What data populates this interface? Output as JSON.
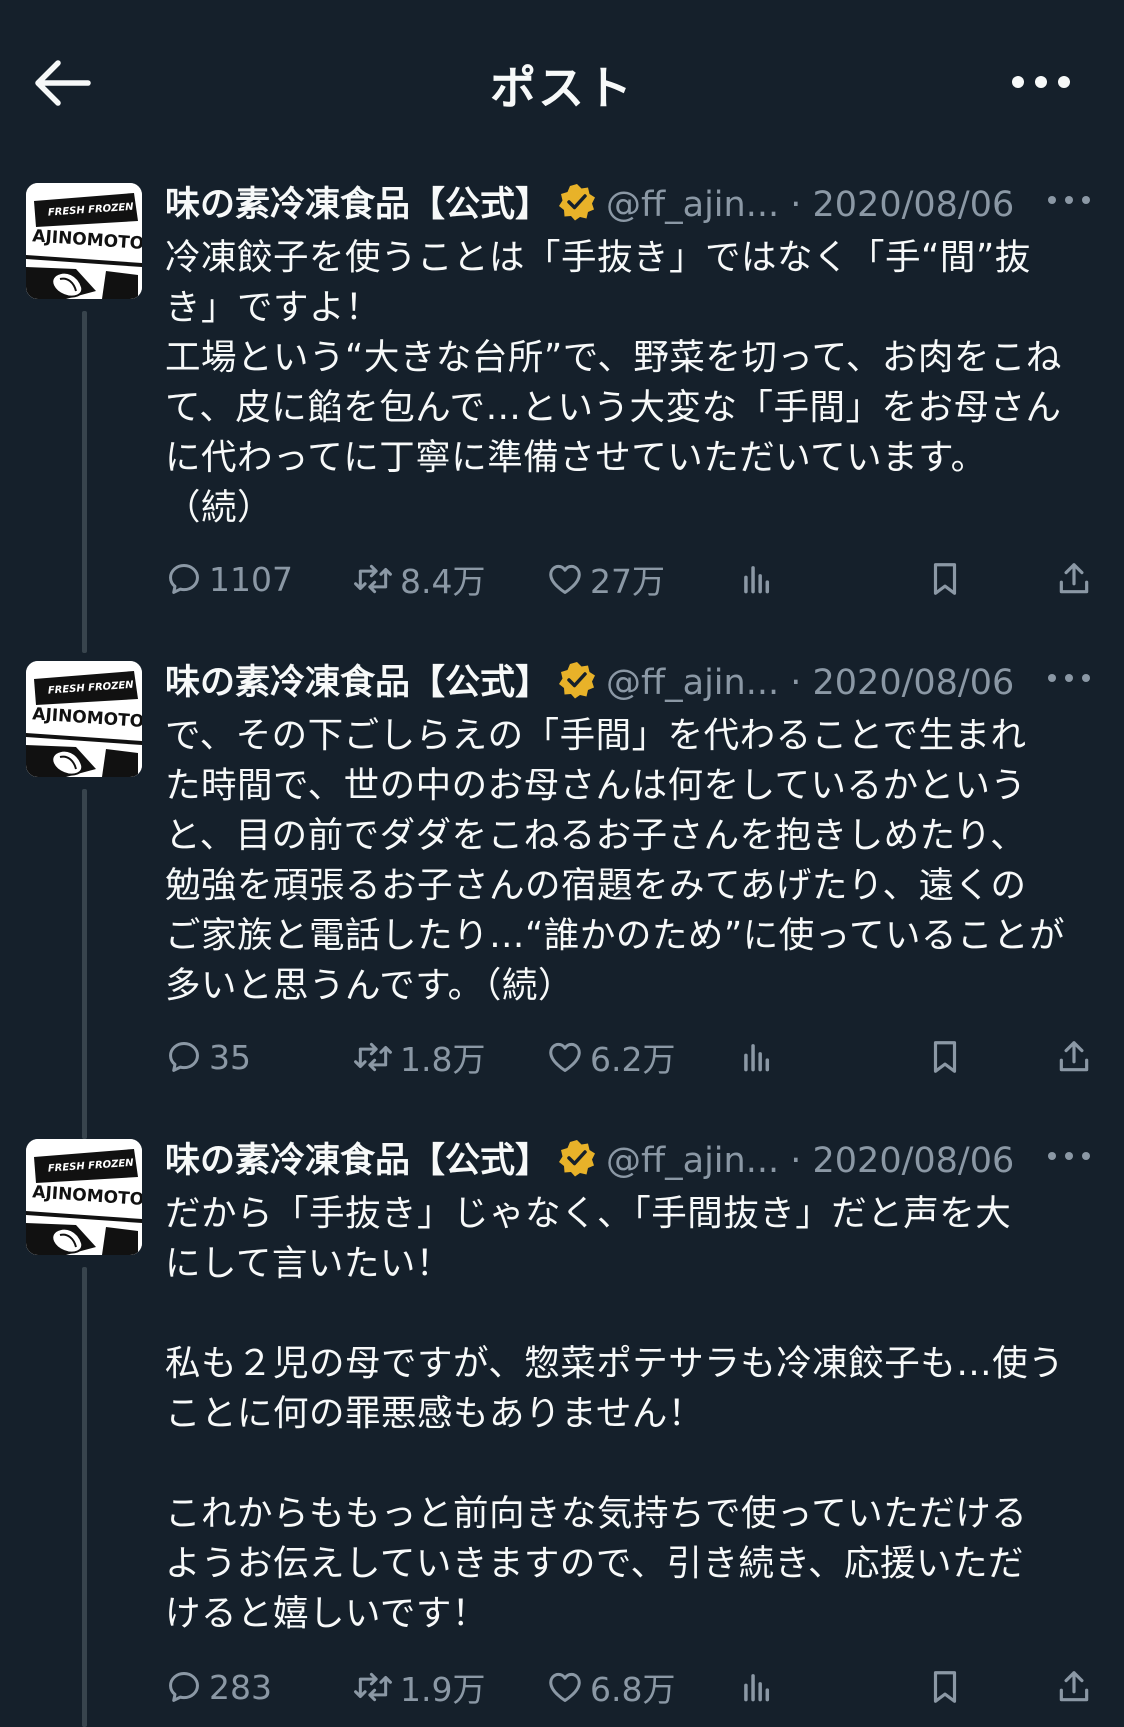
{
  "header": {
    "title": "ポスト",
    "back_icon": "arrow-left-icon",
    "more_icon": "more-horizontal-icon"
  },
  "colors": {
    "background": "#15202b",
    "text": "#f7f9f9",
    "muted": "#8b98a5",
    "verified_badge": "#e8b229",
    "thread_line": "#38444d"
  },
  "posts": [
    {
      "author": "味の素冷凍食品【公式】",
      "handle": "@ff_ajin...",
      "separator": "·",
      "date": "2020/08/06",
      "text": "冷凍餃子を使うことは「手抜き」ではなく「手“間”抜\nき」ですよ！\n工場という“大きな台所”で、野菜を切って、お肉をこね\nて、皮に餡を包んで…という大変な「手間」をお母さん\nに代わってに丁寧に準備させていただいています。\n（続）",
      "replies": "1107",
      "reposts": "8.4万",
      "likes": "27万"
    },
    {
      "author": "味の素冷凍食品【公式】",
      "handle": "@ff_ajin...",
      "separator": "·",
      "date": "2020/08/06",
      "text": "で、その下ごしらえの「手間」を代わることで生まれ\nた時間で、世の中のお母さんは何をしているかという\nと、目の前でダダをこねるお子さんを抱きしめたり、\n勉強を頑張るお子さんの宿題をみてあげたり、遠くの\nご家族と電話したり…“誰かのため”に使っていることが\n多いと思うんです。（続）",
      "replies": "35",
      "reposts": "1.8万",
      "likes": "6.2万"
    },
    {
      "author": "味の素冷凍食品【公式】",
      "handle": "@ff_ajin...",
      "separator": "·",
      "date": "2020/08/06",
      "text": "だから「手抜き」じゃなく、「手間抜き」だと声を大\nにして言いたい！\n\n私も２児の母ですが、惣菜ポテサラも冷凍餃子も…使う\nことに何の罪悪感もありません！\n\nこれからももっと前向きな気持ちで使っていただける\nようお伝えしていきますので、引き続き、応援いただ\nけると嬉しいです！",
      "replies": "283",
      "reposts": "1.9万",
      "likes": "6.8万"
    }
  ],
  "avatar": {
    "line1": "FRESH FROZEN",
    "line2": "AJINOMOTO"
  }
}
